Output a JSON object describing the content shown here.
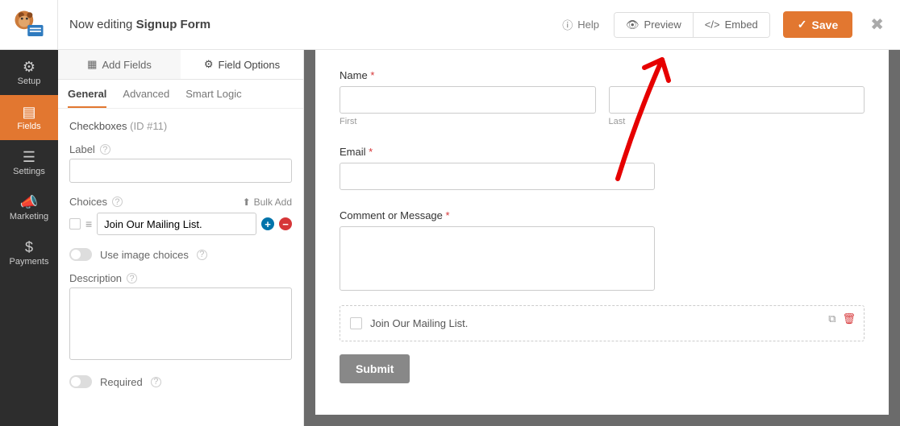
{
  "header": {
    "editing_prefix": "Now editing",
    "form_name": "Signup Form",
    "help": "Help",
    "preview": "Preview",
    "embed": "Embed",
    "save": "Save"
  },
  "leftnav": {
    "items": [
      {
        "label": "Setup",
        "icon": "gear"
      },
      {
        "label": "Fields",
        "icon": "layout"
      },
      {
        "label": "Settings",
        "icon": "sliders"
      },
      {
        "label": "Marketing",
        "icon": "bullhorn"
      },
      {
        "label": "Payments",
        "icon": "dollar"
      }
    ]
  },
  "sidebar": {
    "tabs": {
      "add_fields": "Add Fields",
      "field_options": "Field Options"
    },
    "subtabs": {
      "general": "General",
      "advanced": "Advanced",
      "smart_logic": "Smart Logic"
    },
    "field_options": {
      "type_name": "Checkboxes",
      "id_label": "(ID #11)",
      "label_heading": "Label",
      "label_value": "",
      "choices_heading": "Choices",
      "bulk_add": "Bulk Add",
      "choice_value": "Join Our Mailing List.",
      "image_choices": "Use image choices",
      "description_heading": "Description",
      "description_value": "",
      "required_label": "Required"
    }
  },
  "preview": {
    "name": {
      "label": "Name",
      "first": "First",
      "last": "Last"
    },
    "email": {
      "label": "Email"
    },
    "comment": {
      "label": "Comment or Message"
    },
    "checkbox_option": "Join Our Mailing List.",
    "submit": "Submit"
  }
}
